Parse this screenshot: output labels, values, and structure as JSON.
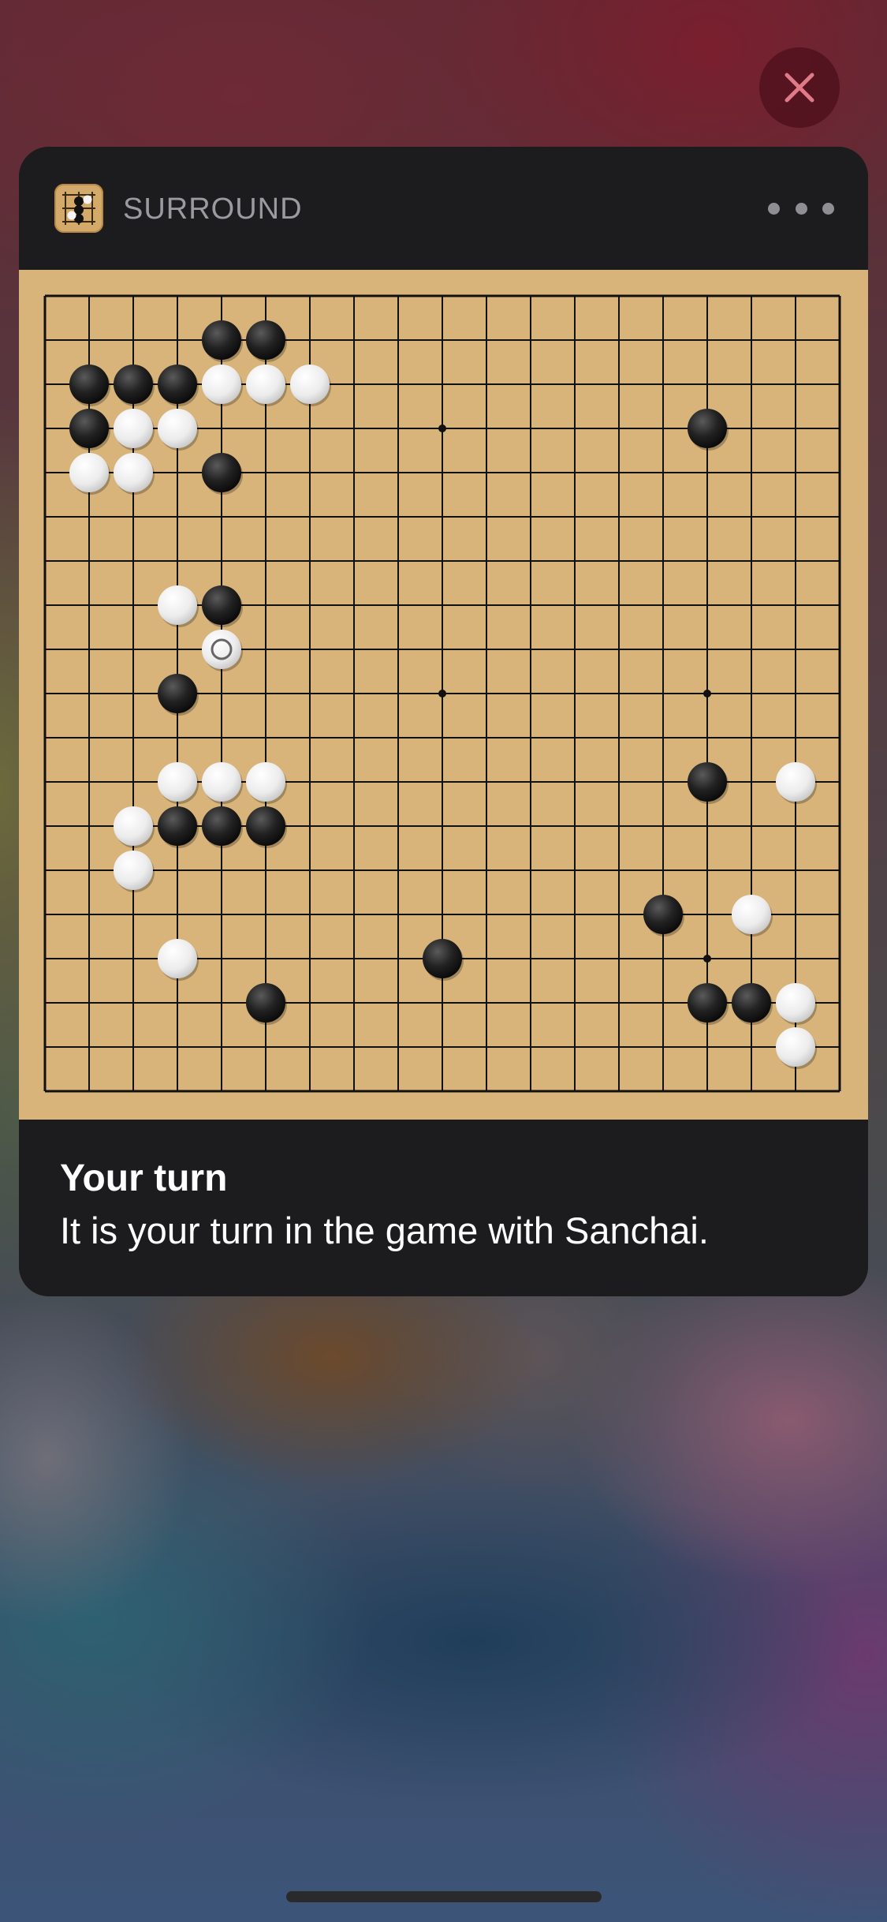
{
  "notification": {
    "app_name": "SURROUND",
    "app_icon": "go-board-icon",
    "title": "Your turn",
    "body": "It is your turn in the game with Sanchai."
  },
  "controls": {
    "close_icon": "close-icon",
    "more_icon": "more-options-icon"
  },
  "colors": {
    "board": "#d8b47a",
    "card": "#1c1c1e",
    "close_button": "#50121c",
    "close_glyph": "#e07a88"
  },
  "board": {
    "size": 19,
    "star_points": [
      [
        9,
        3
      ],
      [
        15,
        3
      ],
      [
        9,
        9
      ],
      [
        15,
        9
      ],
      [
        15,
        15
      ]
    ],
    "stones": [
      {
        "col": 4,
        "row": 1,
        "color": "black"
      },
      {
        "col": 5,
        "row": 1,
        "color": "black"
      },
      {
        "col": 1,
        "row": 2,
        "color": "black"
      },
      {
        "col": 2,
        "row": 2,
        "color": "black"
      },
      {
        "col": 3,
        "row": 2,
        "color": "black"
      },
      {
        "col": 4,
        "row": 2,
        "color": "white"
      },
      {
        "col": 5,
        "row": 2,
        "color": "white"
      },
      {
        "col": 6,
        "row": 2,
        "color": "white"
      },
      {
        "col": 1,
        "row": 3,
        "color": "black"
      },
      {
        "col": 2,
        "row": 3,
        "color": "white"
      },
      {
        "col": 3,
        "row": 3,
        "color": "white"
      },
      {
        "col": 15,
        "row": 3,
        "color": "black"
      },
      {
        "col": 1,
        "row": 4,
        "color": "white"
      },
      {
        "col": 2,
        "row": 4,
        "color": "white"
      },
      {
        "col": 4,
        "row": 4,
        "color": "black"
      },
      {
        "col": 3,
        "row": 7,
        "color": "white"
      },
      {
        "col": 4,
        "row": 7,
        "color": "black"
      },
      {
        "col": 4,
        "row": 8,
        "color": "white",
        "last_move": true
      },
      {
        "col": 3,
        "row": 9,
        "color": "black"
      },
      {
        "col": 3,
        "row": 11,
        "color": "white"
      },
      {
        "col": 4,
        "row": 11,
        "color": "white"
      },
      {
        "col": 5,
        "row": 11,
        "color": "white"
      },
      {
        "col": 15,
        "row": 11,
        "color": "black"
      },
      {
        "col": 17,
        "row": 11,
        "color": "white"
      },
      {
        "col": 2,
        "row": 12,
        "color": "white"
      },
      {
        "col": 3,
        "row": 12,
        "color": "black"
      },
      {
        "col": 4,
        "row": 12,
        "color": "black"
      },
      {
        "col": 5,
        "row": 12,
        "color": "black"
      },
      {
        "col": 2,
        "row": 13,
        "color": "white"
      },
      {
        "col": 14,
        "row": 14,
        "color": "black"
      },
      {
        "col": 16,
        "row": 14,
        "color": "white"
      },
      {
        "col": 3,
        "row": 15,
        "color": "white"
      },
      {
        "col": 9,
        "row": 15,
        "color": "black"
      },
      {
        "col": 5,
        "row": 16,
        "color": "black"
      },
      {
        "col": 15,
        "row": 16,
        "color": "black"
      },
      {
        "col": 16,
        "row": 16,
        "color": "black"
      },
      {
        "col": 17,
        "row": 16,
        "color": "white"
      },
      {
        "col": 17,
        "row": 17,
        "color": "white"
      }
    ]
  }
}
